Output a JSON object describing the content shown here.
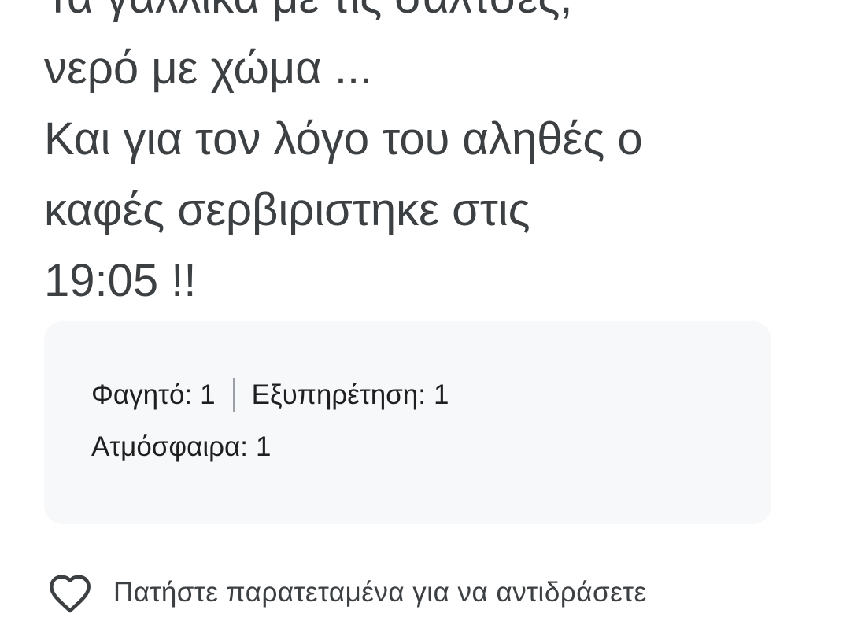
{
  "review": {
    "lines": [
      "Τα γαλλικά με τις σάλτσες,",
      "νερό με χώμα ...",
      "Και για τον λόγο του αληθές ο",
      "καφές σερβιριστηκε στις",
      "19:05 !!"
    ]
  },
  "ratings": {
    "food_label": "Φαγητό:",
    "food_value": "1",
    "service_label": "Εξυπηρέτηση:",
    "service_value": "1",
    "atmosphere_label": "Ατμόσφαιρα:",
    "atmosphere_value": "1"
  },
  "reaction": {
    "icon": "heart-outline-icon",
    "label": "Πατήστε παρατεταμένα για να αντιδράσετε"
  }
}
